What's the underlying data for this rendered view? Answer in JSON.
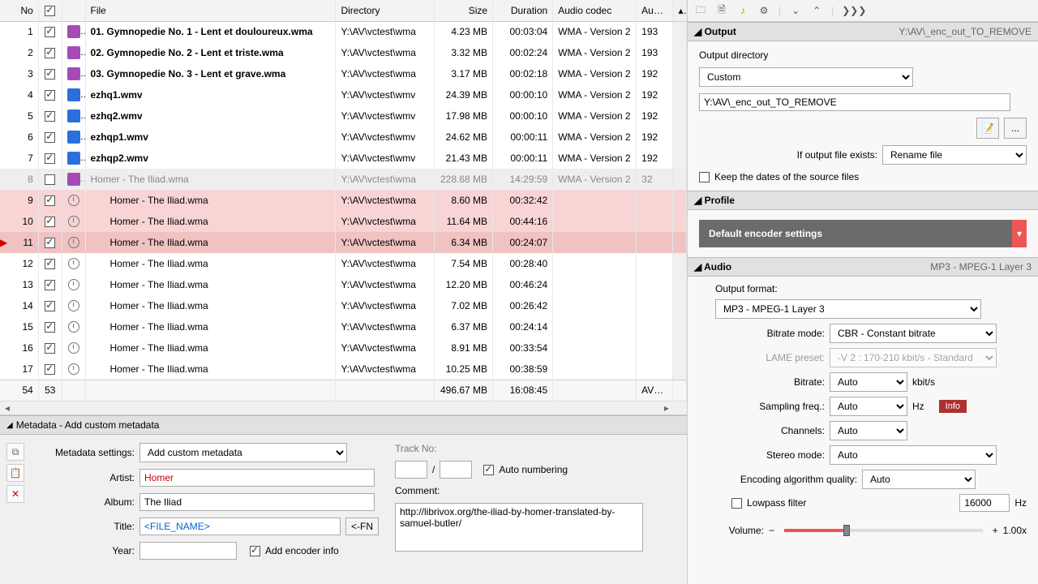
{
  "columns": [
    "No",
    "",
    "",
    "File",
    "Directory",
    "Size",
    "Duration",
    "Audio codec",
    "Audi..."
  ],
  "rows": [
    {
      "no": 1,
      "chk": true,
      "ico": "wma",
      "file": "01. Gymnopedie No. 1 - Lent et douloureux.wma",
      "dir": "Y:\\AV\\vctest\\wma",
      "size": "4.23 MB",
      "dur": "00:03:04",
      "codec": "WMA - Version 2",
      "br": "193",
      "bold": true
    },
    {
      "no": 2,
      "chk": true,
      "ico": "wma",
      "file": "02. Gymnopedie No. 2 - Lent et triste.wma",
      "dir": "Y:\\AV\\vctest\\wma",
      "size": "3.32 MB",
      "dur": "00:02:24",
      "codec": "WMA - Version 2",
      "br": "193",
      "bold": true
    },
    {
      "no": 3,
      "chk": true,
      "ico": "wma",
      "file": "03. Gymnopedie No. 3 - Lent et grave.wma",
      "dir": "Y:\\AV\\vctest\\wma",
      "size": "3.17 MB",
      "dur": "00:02:18",
      "codec": "WMA - Version 2",
      "br": "192",
      "bold": true
    },
    {
      "no": 4,
      "chk": true,
      "ico": "wmv",
      "file": "ezhq1.wmv",
      "dir": "Y:\\AV\\vctest\\wmv",
      "size": "24.39 MB",
      "dur": "00:00:10",
      "codec": "WMA - Version 2",
      "br": "192",
      "bold": true
    },
    {
      "no": 5,
      "chk": true,
      "ico": "wmv",
      "file": "ezhq2.wmv",
      "dir": "Y:\\AV\\vctest\\wmv",
      "size": "17.98 MB",
      "dur": "00:00:10",
      "codec": "WMA - Version 2",
      "br": "192",
      "bold": true
    },
    {
      "no": 6,
      "chk": true,
      "ico": "wmv",
      "file": "ezhqp1.wmv",
      "dir": "Y:\\AV\\vctest\\wmv",
      "size": "24.62 MB",
      "dur": "00:00:11",
      "codec": "WMA - Version 2",
      "br": "192",
      "bold": true
    },
    {
      "no": 7,
      "chk": true,
      "ico": "wmv",
      "file": "ezhqp2.wmv",
      "dir": "Y:\\AV\\vctest\\wmv",
      "size": "21.43 MB",
      "dur": "00:00:11",
      "codec": "WMA - Version 2",
      "br": "192",
      "bold": true
    },
    {
      "no": 8,
      "chk": false,
      "ico": "wma",
      "file": "Homer - The Iliad.wma",
      "dir": "Y:\\AV\\vctest\\wma",
      "size": "228.68 MB",
      "dur": "14:29:59",
      "codec": "WMA - Version 2",
      "br": "32",
      "gray": true
    },
    {
      "no": 9,
      "chk": true,
      "ico": "clock",
      "file": "Homer - The Iliad.wma",
      "dir": "Y:\\AV\\vctest\\wma",
      "size": "8.60 MB",
      "dur": "00:32:42",
      "codec": "",
      "br": "",
      "pink": true,
      "indent": true
    },
    {
      "no": 10,
      "chk": true,
      "ico": "clock",
      "file": "Homer - The Iliad.wma",
      "dir": "Y:\\AV\\vctest\\wma",
      "size": "11.64 MB",
      "dur": "00:44:16",
      "codec": "",
      "br": "",
      "pink": true,
      "indent": true
    },
    {
      "no": 11,
      "chk": true,
      "ico": "clock",
      "file": "Homer - The Iliad.wma",
      "dir": "Y:\\AV\\vctest\\wma",
      "size": "6.34 MB",
      "dur": "00:24:07",
      "codec": "",
      "br": "",
      "pink": true,
      "sel": true,
      "indent": true,
      "play": true
    },
    {
      "no": 12,
      "chk": true,
      "ico": "clock",
      "file": "Homer - The Iliad.wma",
      "dir": "Y:\\AV\\vctest\\wma",
      "size": "7.54 MB",
      "dur": "00:28:40",
      "codec": "",
      "br": "",
      "indent": true
    },
    {
      "no": 13,
      "chk": true,
      "ico": "clock",
      "file": "Homer - The Iliad.wma",
      "dir": "Y:\\AV\\vctest\\wma",
      "size": "12.20 MB",
      "dur": "00:46:24",
      "codec": "",
      "br": "",
      "indent": true
    },
    {
      "no": 14,
      "chk": true,
      "ico": "clock",
      "file": "Homer - The Iliad.wma",
      "dir": "Y:\\AV\\vctest\\wma",
      "size": "7.02 MB",
      "dur": "00:26:42",
      "codec": "",
      "br": "",
      "indent": true
    },
    {
      "no": 15,
      "chk": true,
      "ico": "clock",
      "file": "Homer - The Iliad.wma",
      "dir": "Y:\\AV\\vctest\\wma",
      "size": "6.37 MB",
      "dur": "00:24:14",
      "codec": "",
      "br": "",
      "indent": true
    },
    {
      "no": 16,
      "chk": true,
      "ico": "clock",
      "file": "Homer - The Iliad.wma",
      "dir": "Y:\\AV\\vctest\\wma",
      "size": "8.91 MB",
      "dur": "00:33:54",
      "codec": "",
      "br": "",
      "indent": true
    },
    {
      "no": 17,
      "chk": true,
      "ico": "clock",
      "file": "Homer - The Iliad.wma",
      "dir": "Y:\\AV\\vctest\\wma",
      "size": "10.25 MB",
      "dur": "00:38:59",
      "codec": "",
      "br": "",
      "indent": true
    }
  ],
  "summary": {
    "total": "54",
    "checked": "53",
    "size": "496.67 MB",
    "dur": "16:08:45",
    "avg": "AVG .."
  },
  "meta": {
    "title": "Metadata - Add custom metadata",
    "settings_label": "Metadata settings:",
    "settings_value": "Add custom metadata",
    "artist_label": "Artist:",
    "artist_value": "Homer",
    "album_label": "Album:",
    "album_value": "The Iliad",
    "title_label": "Title:",
    "title_value": "<FILE_NAME>",
    "fn_btn": "<-FN",
    "year_label": "Year:",
    "year_value": "",
    "add_encoder": "Add encoder info",
    "trackno_label": "Track No:",
    "sep": "/",
    "auto_num": "Auto numbering",
    "comment_label": "Comment:",
    "comment_value": "http://librivox.org/the-iliad-by-homer-translated-by-samuel-butler/"
  },
  "output": {
    "header": "Output",
    "path_display": "Y:\\AV\\_enc_out_TO_REMOVE",
    "dir_label": "Output directory",
    "dir_mode": "Custom",
    "dir_value": "Y:\\AV\\_enc_out_TO_REMOVE",
    "exists_label": "If output file exists:",
    "exists_value": "Rename file",
    "keep_dates": "Keep the dates of the source files"
  },
  "profile": {
    "header": "Profile",
    "name": "Default encoder settings"
  },
  "audio": {
    "header": "Audio",
    "codec_display": "MP3 - MPEG-1 Layer 3",
    "format_label": "Output format:",
    "format_value": "MP3 - MPEG-1 Layer 3",
    "brmode_label": "Bitrate mode:",
    "brmode_value": "CBR - Constant bitrate",
    "lame_label": "LAME preset:",
    "lame_value": "-V 2 : 170-210 kbit/s - Standard",
    "bitrate_label": "Bitrate:",
    "bitrate_value": "Auto",
    "bitrate_unit": "kbit/s",
    "samp_label": "Sampling freq.:",
    "samp_value": "Auto",
    "samp_unit": "Hz",
    "ch_label": "Channels:",
    "ch_value": "Auto",
    "stereo_label": "Stereo mode:",
    "stereo_value": "Auto",
    "enc_q_label": "Encoding algorithm quality:",
    "enc_q_value": "Auto",
    "lowpass": "Lowpass filter",
    "lowpass_value": "16000",
    "lowpass_unit": "Hz",
    "info": "Info",
    "vol_label": "Volume:",
    "vol_value": "1.00x"
  }
}
